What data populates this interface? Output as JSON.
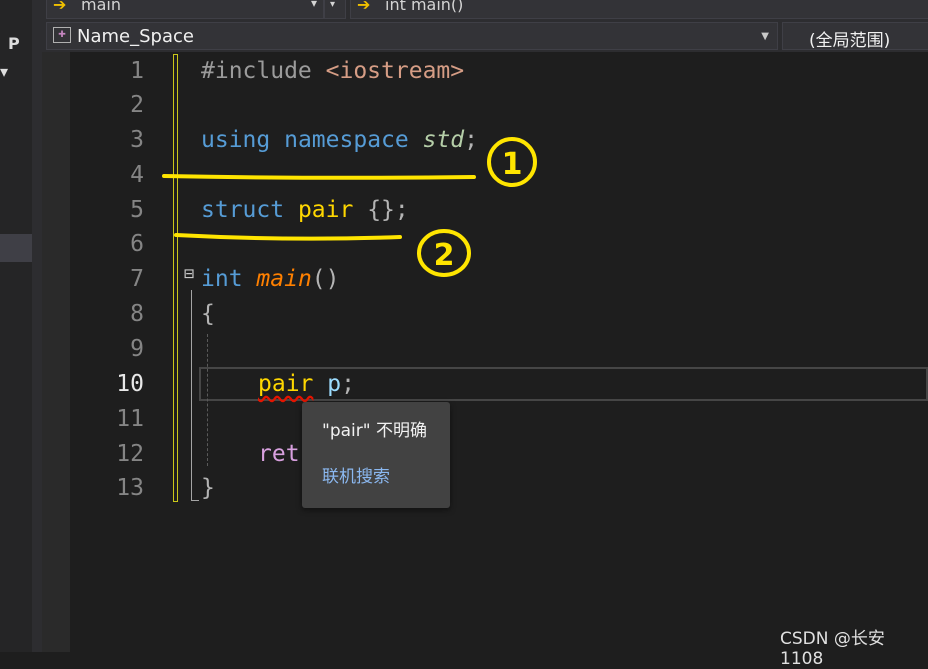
{
  "topbar": {
    "left_dropdown": "main",
    "right_dropdown": "int main()"
  },
  "navbar": {
    "scope_left": "Name_Space",
    "scope_right": "(全局范围)"
  },
  "editor": {
    "line_numbers": [
      "1",
      "2",
      "3",
      "4",
      "5",
      "6",
      "7",
      "8",
      "9",
      "10",
      "11",
      "12",
      "13"
    ],
    "current_line": "10",
    "code": {
      "line1_directive": "#include",
      "line1_header": "<iostream>",
      "line3_using": "using",
      "line3_namespace": "namespace",
      "line3_std": "std",
      "line3_semi": ";",
      "line5_struct": "struct",
      "line5_pair": "pair",
      "line5_rest": "{};",
      "line7_int": "int",
      "line7_main": "main",
      "line7_parens": "()",
      "line8_brace": "{",
      "line10_pair": "pair",
      "line10_p": "p",
      "line10_semi": ";",
      "line12_ret": "ret",
      "line13_brace": "}"
    },
    "fold_marker": "⊟"
  },
  "tooltip": {
    "message": "\"pair\" 不明确",
    "link": "联机搜索"
  },
  "annotations": {
    "circle1": "1",
    "circle2": "2",
    "color": "#ffe500"
  },
  "watermark": "CSDN @长安1108"
}
